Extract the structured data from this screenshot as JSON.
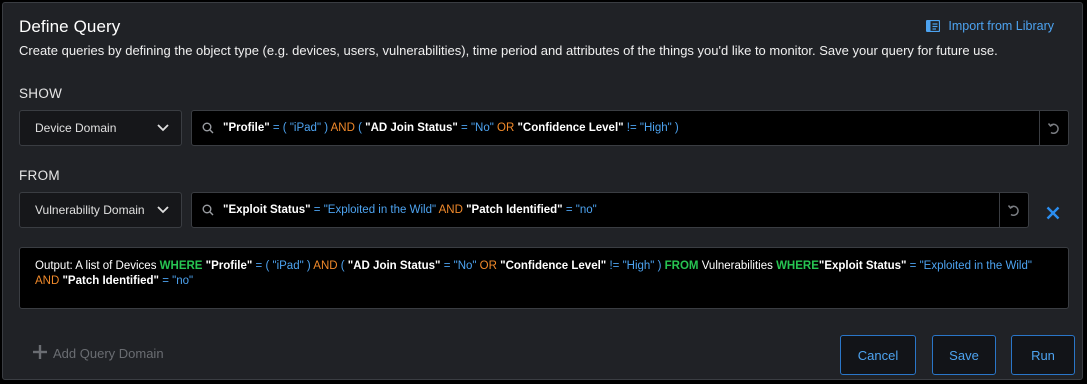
{
  "header": {
    "title": "Define Query",
    "import_label": "Import from Library",
    "description": "Create queries by defining the object type (e.g. devices, users, vulnerabilities), time period and attributes of the things you'd like to monitor. Save your query for future use."
  },
  "show": {
    "label": "SHOW",
    "domain": "Device Domain",
    "query": [
      {
        "t": "\"Profile\"",
        "c": "f"
      },
      {
        "t": " = ( ",
        "c": "op"
      },
      {
        "t": "\"iPad\"",
        "c": "val"
      },
      {
        "t": " )   ",
        "c": "op"
      },
      {
        "t": "AND",
        "c": "kw"
      },
      {
        "t": " ( ",
        "c": "op"
      },
      {
        "t": "\"AD Join Status\"",
        "c": "f"
      },
      {
        "t": " = ",
        "c": "op"
      },
      {
        "t": "\"No\"",
        "c": "val"
      },
      {
        "t": " OR ",
        "c": "kw"
      },
      {
        "t": "\"Confidence Level\"",
        "c": "f"
      },
      {
        "t": " != ",
        "c": "op"
      },
      {
        "t": "\"High\"",
        "c": "val"
      },
      {
        "t": " )",
        "c": "op"
      }
    ]
  },
  "from": {
    "label": "FROM",
    "domain": "Vulnerability Domain",
    "query": [
      {
        "t": "\"Exploit Status\"",
        "c": "f"
      },
      {
        "t": " = ",
        "c": "op"
      },
      {
        "t": "\"Exploited in the Wild\"",
        "c": "val"
      },
      {
        "t": "  AND ",
        "c": "kw"
      },
      {
        "t": "\"Patch Identified\"",
        "c": "f"
      },
      {
        "t": " = ",
        "c": "op"
      },
      {
        "t": "\"no\"",
        "c": "val"
      }
    ]
  },
  "output": [
    {
      "t": "Output: A list of Devices ",
      "c": ""
    },
    {
      "t": "WHERE ",
      "c": "g"
    },
    {
      "t": "\"Profile\"",
      "c": "f"
    },
    {
      "t": " = ( ",
      "c": "op"
    },
    {
      "t": "\"iPad\"",
      "c": "val"
    },
    {
      "t": " )   ",
      "c": "op"
    },
    {
      "t": "AND",
      "c": "kw"
    },
    {
      "t": " ( ",
      "c": "op"
    },
    {
      "t": "\"AD Join Status\"",
      "c": "f"
    },
    {
      "t": " = ",
      "c": "op"
    },
    {
      "t": "\"No\"",
      "c": "val"
    },
    {
      "t": " OR ",
      "c": "kw"
    },
    {
      "t": "\"Confidence Level\"",
      "c": "f"
    },
    {
      "t": " != ",
      "c": "op"
    },
    {
      "t": "\"High\"",
      "c": "val"
    },
    {
      "t": " )  ",
      "c": "op"
    },
    {
      "t": "FROM ",
      "c": "g"
    },
    {
      "t": "Vulnerabilities ",
      "c": ""
    },
    {
      "t": "WHERE",
      "c": "g"
    },
    {
      "t": "\"Exploit Status\"",
      "c": "f"
    },
    {
      "t": " = ",
      "c": "op"
    },
    {
      "t": "\"Exploited in the Wild\"",
      "c": "val"
    },
    {
      "t": "  AND ",
      "c": "kw"
    },
    {
      "t": "\"Patch Identified\"",
      "c": "f"
    },
    {
      "t": " = ",
      "c": "op"
    },
    {
      "t": "\"no\"",
      "c": "val"
    }
  ],
  "footer": {
    "add_domain_label": "Add Query Domain",
    "cancel_label": "Cancel",
    "save_label": "Save",
    "run_label": "Run"
  },
  "colors": {
    "accent": "#4da3f0",
    "keyword_orange": "#f0892a",
    "keyword_green": "#27c452",
    "close_icon": "#2b8ef0"
  },
  "icons": [
    "library-icon",
    "chevron-down-icon",
    "search-icon",
    "undo-icon",
    "close-icon",
    "plus-icon"
  ]
}
